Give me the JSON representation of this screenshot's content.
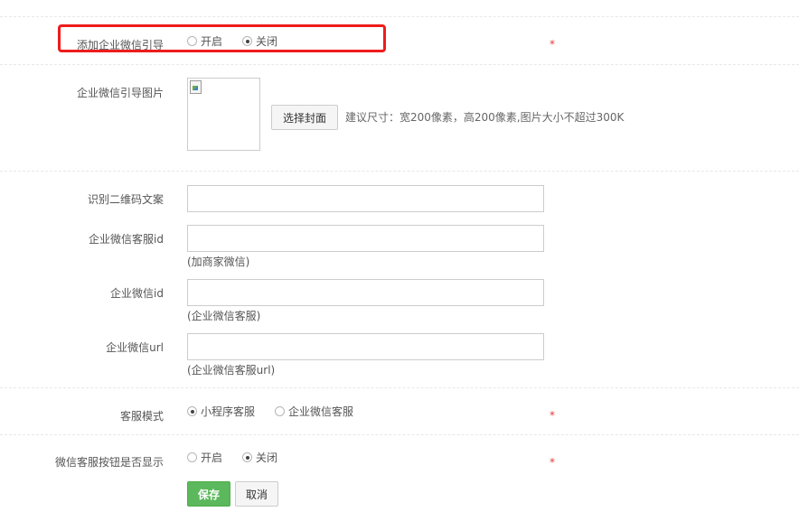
{
  "guide": {
    "label": "添加企业微信引导",
    "options": [
      "开启",
      "关闭"
    ],
    "selected": "关闭",
    "required_mark": "*"
  },
  "guide_image": {
    "label": "企业微信引导图片",
    "button": "选择封面",
    "hint": "建议尺寸：宽200像素，高200像素,图片大小不超过300K"
  },
  "qr_text": {
    "label": "识别二维码文案",
    "value": ""
  },
  "service_id": {
    "label": "企业微信客服id",
    "value": "",
    "help": "(加商家微信)"
  },
  "wework_id": {
    "label": "企业微信id",
    "value": "",
    "help": "(企业微信客服)"
  },
  "wework_url": {
    "label": "企业微信url",
    "value": "",
    "help": "(企业微信客服url)"
  },
  "service_mode": {
    "label": "客服模式",
    "options": [
      "小程序客服",
      "企业微信客服"
    ],
    "selected": "小程序客服",
    "required_mark": "*"
  },
  "service_button": {
    "label": "微信客服按钮是否显示",
    "options": [
      "开启",
      "关闭"
    ],
    "selected": "关闭",
    "required_mark": "*"
  },
  "actions": {
    "save": "保存",
    "cancel": "取消"
  },
  "colors": {
    "highlight": "#ee1c1c",
    "save_button": "#5cb85c",
    "required": "#e4393c"
  }
}
